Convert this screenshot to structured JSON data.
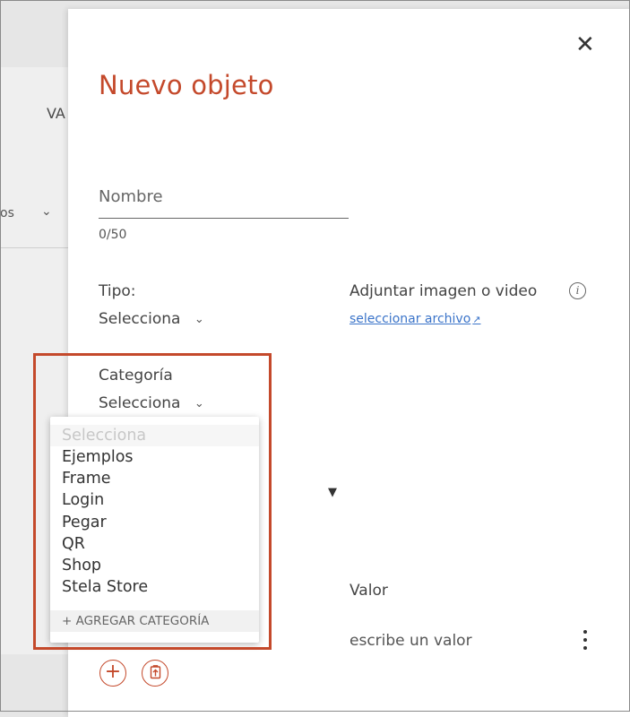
{
  "background": {
    "column_label": "VA",
    "truncated_label": "os"
  },
  "panel": {
    "title": "Nuevo objeto",
    "close_icon": "close-icon",
    "name_field": {
      "placeholder": "Nombre",
      "counter": "0/50"
    },
    "tipo": {
      "label": "Tipo:",
      "selected": "Selecciona"
    },
    "attach": {
      "label": "Adjuntar imagen o video",
      "link": "seleccionar archivo",
      "info_glyph": "i",
      "external_glyph": "↗"
    },
    "categoria": {
      "label": "Categoría",
      "selected": "Selecciona"
    },
    "valor": {
      "label": "Valor",
      "placeholder": "escribe un valor"
    },
    "buttons": {
      "add_glyph": "+"
    }
  },
  "dropdown": {
    "placeholder": "Selecciona",
    "options": [
      "Ejemplos",
      "Frame",
      "Login",
      "Pegar",
      "QR",
      "Shop",
      "Stela Store"
    ],
    "add_label": "+ AGREGAR CATEGORÍA"
  },
  "colors": {
    "accent": "#c4492b",
    "link": "#3b74c9",
    "highlight_border": "#c4492b"
  }
}
